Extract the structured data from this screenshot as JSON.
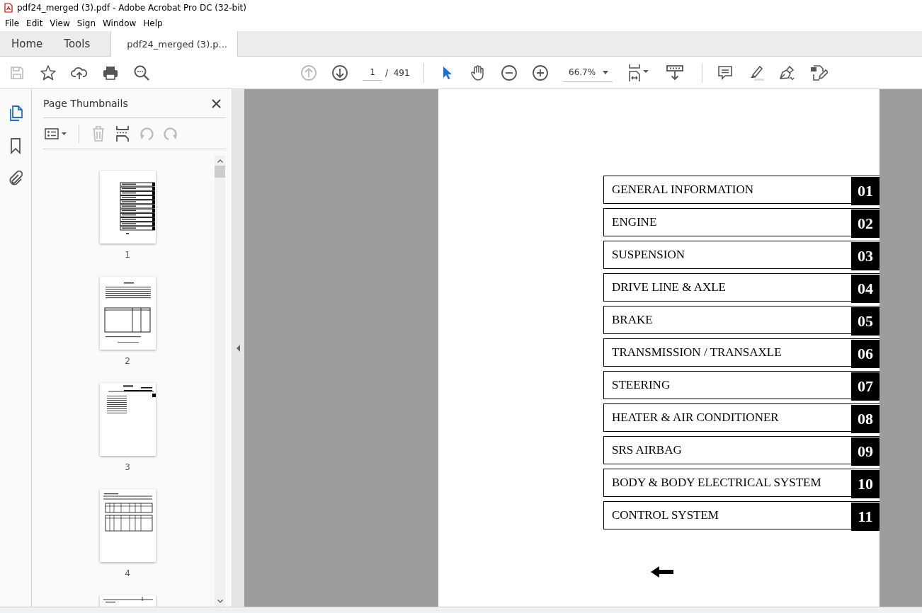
{
  "window": {
    "title": "pdf24_merged (3).pdf - Adobe Acrobat Pro DC (32-bit)"
  },
  "menu": [
    "File",
    "Edit",
    "View",
    "Sign",
    "Window",
    "Help"
  ],
  "tabs": [
    {
      "label": "Home",
      "kind": "nav",
      "selected": false
    },
    {
      "label": "Tools",
      "kind": "nav",
      "selected": false
    },
    {
      "label": "pdf24_merged (3).p...",
      "kind": "document",
      "selected": true
    }
  ],
  "toolbar": {
    "page": "1",
    "page_total": "/  491",
    "zoom": "66.7%"
  },
  "left_rail": [
    {
      "kind": "pages",
      "selected": true
    },
    {
      "kind": "bookmarks",
      "selected": false
    },
    {
      "kind": "attachments",
      "selected": false
    }
  ],
  "thumbnails_panel": {
    "title": "Page Thumbnails",
    "thumbnails": [
      {
        "label": "1",
        "kind": "contents"
      },
      {
        "label": "2",
        "kind": "notice"
      },
      {
        "label": "3",
        "kind": "chapter"
      },
      {
        "label": "4",
        "kind": "table"
      },
      {
        "kind": "header"
      }
    ]
  },
  "document": {
    "sections": [
      {
        "title": "GENERAL INFORMATION",
        "number": "01"
      },
      {
        "title": "ENGINE",
        "number": "02"
      },
      {
        "title": "SUSPENSION",
        "number": "03"
      },
      {
        "title": "DRIVE LINE & AXLE",
        "number": "04"
      },
      {
        "title": "BRAKE",
        "number": "05"
      },
      {
        "title": "TRANSMISSION / TRANSAXLE",
        "number": "06"
      },
      {
        "title": "STEERING",
        "number": "07"
      },
      {
        "title": "HEATER & AIR CONDITIONER",
        "number": "08"
      },
      {
        "title": "SRS AIRBAG",
        "number": "09"
      },
      {
        "title": "BODY & BODY ELECTRICAL SYSTEM",
        "number": "10"
      },
      {
        "title": "CONTROL SYSTEM",
        "number": "11"
      }
    ]
  }
}
